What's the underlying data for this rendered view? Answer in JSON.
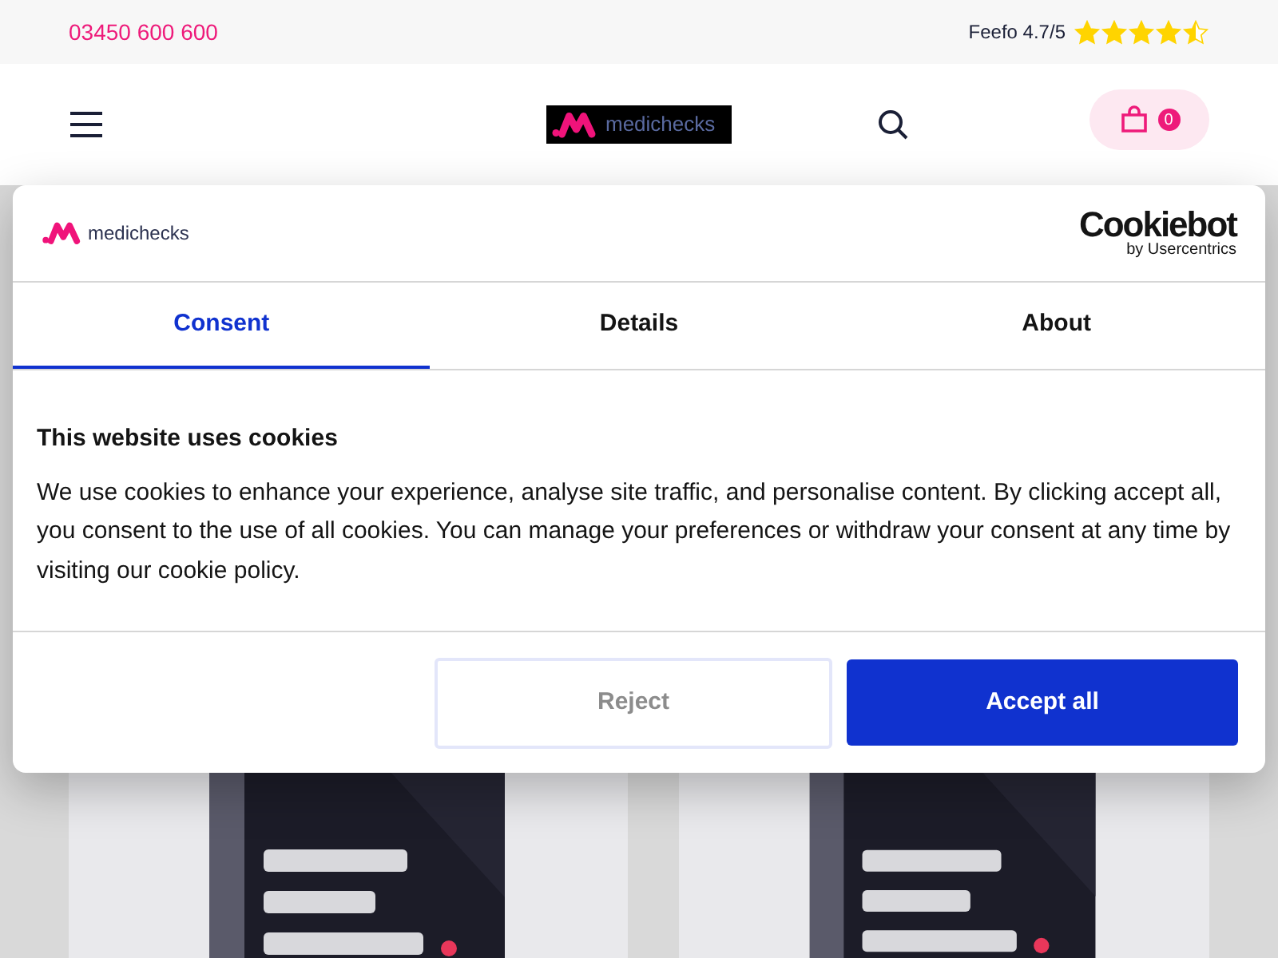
{
  "top_bar": {
    "phone": "03450 600 600",
    "rating_label": "Feefo 4.7/5",
    "stars": 4.5
  },
  "header": {
    "logo_text": "medichecks",
    "cart_count": "0"
  },
  "cookie_dialog": {
    "brand_logo_text": "medichecks",
    "provider_name": "Cookiebot",
    "provider_sub": "by Usercentrics",
    "tabs": [
      {
        "label": "Consent",
        "selected": true
      },
      {
        "label": "Details",
        "selected": false
      },
      {
        "label": "About",
        "selected": false
      }
    ],
    "title": "This website uses cookies",
    "body": "We use cookies to enhance your experience, analyse site traffic, and personalise content. By clicking accept all, you consent to the use of all cookies. You can manage your preferences or withdraw your consent at any time by visiting our cookie policy.",
    "buttons": [
      {
        "label": "Reject",
        "kind": "secondary"
      },
      {
        "label": "Accept all",
        "kind": "primary"
      }
    ]
  }
}
